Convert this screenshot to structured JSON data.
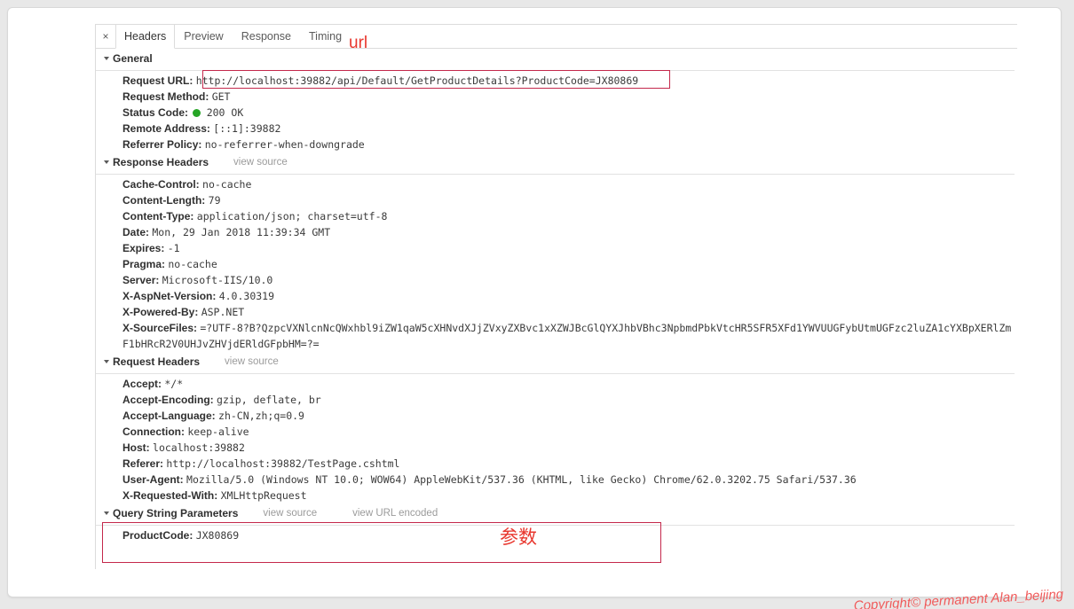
{
  "tabs": {
    "close_label": "×",
    "items": [
      {
        "label": "Headers",
        "active": true
      },
      {
        "label": "Preview",
        "active": false
      },
      {
        "label": "Response",
        "active": false
      },
      {
        "label": "Timing",
        "active": false
      }
    ]
  },
  "annotations": {
    "url_label": "url",
    "params_label": "参数",
    "box_color": "#c4284b",
    "text_color": "#e8362d"
  },
  "general": {
    "title": "General",
    "rows": [
      {
        "key": "Request URL:",
        "value": "http://localhost:39882/api/Default/GetProductDetails?ProductCode=JX80869"
      },
      {
        "key": "Request Method:",
        "value": "GET"
      },
      {
        "key": "Status Code:",
        "value": "200 OK",
        "has_status_dot": true,
        "dot_color": "#26a526"
      },
      {
        "key": "Remote Address:",
        "value": "[::1]:39882"
      },
      {
        "key": "Referrer Policy:",
        "value": "no-referrer-when-downgrade"
      }
    ]
  },
  "response_headers": {
    "title": "Response Headers",
    "view_source": "view source",
    "rows": [
      {
        "key": "Cache-Control:",
        "value": "no-cache"
      },
      {
        "key": "Content-Length:",
        "value": "79"
      },
      {
        "key": "Content-Type:",
        "value": "application/json; charset=utf-8"
      },
      {
        "key": "Date:",
        "value": "Mon, 29 Jan 2018 11:39:34 GMT"
      },
      {
        "key": "Expires:",
        "value": "-1"
      },
      {
        "key": "Pragma:",
        "value": "no-cache"
      },
      {
        "key": "Server:",
        "value": "Microsoft-IIS/10.0"
      },
      {
        "key": "X-AspNet-Version:",
        "value": "4.0.30319"
      },
      {
        "key": "X-Powered-By:",
        "value": "ASP.NET"
      },
      {
        "key": "X-SourceFiles:",
        "value": "=?UTF-8?B?QzpcVXNlcnNcQWxhbl9iZW1qaW5cXHNvdXJjZVxyZXBvc1xXZWJBcGlQYXJhbVBhc3NpbmdPbkVtcHR5SFR5XFd1YWVUUGFybUtmUGFzc2luZA1cYXBpXERlZmF1bHRcR2V0UHJvZHVjdERldGFpbHM=?="
      }
    ]
  },
  "request_headers": {
    "title": "Request Headers",
    "view_source": "view source",
    "rows": [
      {
        "key": "Accept:",
        "value": "*/*"
      },
      {
        "key": "Accept-Encoding:",
        "value": "gzip, deflate, br"
      },
      {
        "key": "Accept-Language:",
        "value": "zh-CN,zh;q=0.9"
      },
      {
        "key": "Connection:",
        "value": "keep-alive"
      },
      {
        "key": "Host:",
        "value": "localhost:39882"
      },
      {
        "key": "Referer:",
        "value": "http://localhost:39882/TestPage.cshtml"
      },
      {
        "key": "User-Agent:",
        "value": "Mozilla/5.0 (Windows NT 10.0; WOW64) AppleWebKit/537.36 (KHTML, like Gecko) Chrome/62.0.3202.75 Safari/537.36"
      },
      {
        "key": "X-Requested-With:",
        "value": "XMLHttpRequest"
      }
    ]
  },
  "query_string": {
    "title": "Query String Parameters",
    "view_source": "view source",
    "view_url_encoded": "view URL encoded",
    "rows": [
      {
        "key": "ProductCode:",
        "value": "JX80869"
      }
    ]
  },
  "watermark": {
    "text": "Copyright© permanent  Alan_beijing"
  }
}
